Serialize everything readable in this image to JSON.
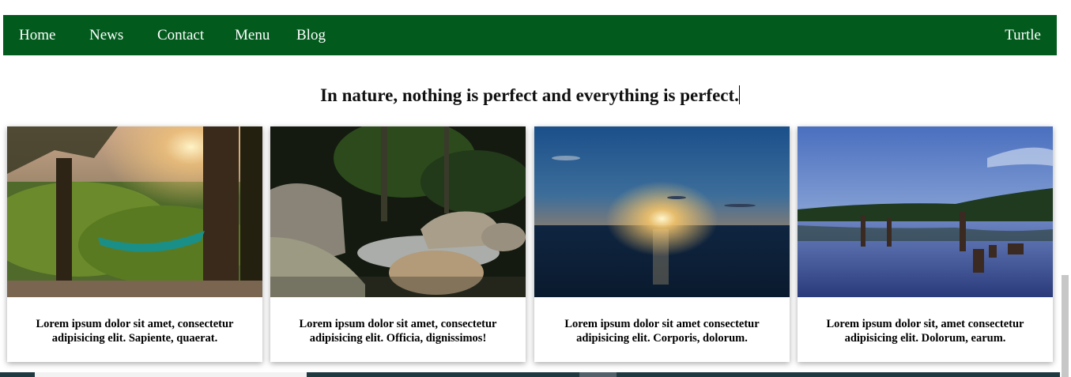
{
  "nav": {
    "items": [
      {
        "label": "Home"
      },
      {
        "label": "News"
      },
      {
        "label": "Contact"
      },
      {
        "label": "Menu"
      },
      {
        "label": "Blog"
      }
    ],
    "brand": "Turtle"
  },
  "quote": "In nature, nothing is perfect and everything is perfect.",
  "cards": [
    {
      "caption": "Lorem ipsum dolor sit amet, consectetur adipisicing elit. Sapiente, quaerat.",
      "image": "forest-hammock-photo"
    },
    {
      "caption": "Lorem ipsum dolor sit amet, consectetur adipisicing elit. Officia, dignissimos!",
      "image": "forest-stream-rocks-photo"
    },
    {
      "caption": "Lorem ipsum dolor sit amet consectetur adipisicing elit. Corporis, dolorum.",
      "image": "ocean-sunset-photo"
    },
    {
      "caption": "Lorem ipsum dolor sit, amet consectetur adipisicing elit. Dolorum, earum.",
      "image": "lake-pilings-dusk-photo"
    }
  ],
  "colors": {
    "nav_bg": "#025b1d",
    "nav_text": "#ffffff"
  }
}
